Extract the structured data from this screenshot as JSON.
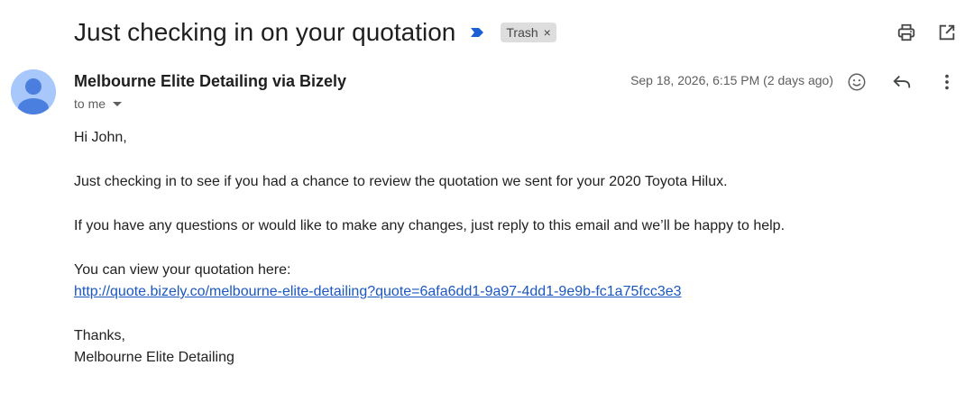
{
  "header": {
    "subject": "Just checking in on your quotation",
    "label": "Trash",
    "importance_icon": "importance-marker-icon",
    "print_icon": "print-icon",
    "open_new_window_icon": "open-in-new-icon"
  },
  "message": {
    "sender": "Melbourne Elite Detailing via Bizely",
    "recipient": "to me",
    "date": "Sep 18, 2026, 6:15 PM (2 days ago)",
    "avatar_icon": "default-person-avatar",
    "actions": {
      "emoji_icon": "emoji-reaction-icon",
      "reply_icon": "reply-icon",
      "more_icon": "more-vert-icon"
    }
  },
  "body": {
    "greeting": "Hi John,",
    "paragraph1": "Just checking in to see if you had a chance to review the quotation we sent for your 2020 Toyota Hilux.",
    "paragraph2": "If you have any questions or would like to make any changes, just reply to this email and we’ll be happy to help.",
    "view_text": "You can view your quotation here:",
    "link": "http://quote.bizely.co/melbourne-elite-detailing?quote=6afa6dd1-9a97-4dd1-9e9b-fc1a75fcc3e3",
    "signoff": "Thanks,",
    "signature": "Melbourne Elite Detailing"
  },
  "colors": {
    "link": "#1a57c0",
    "label_chip_bg": "#dddddd",
    "avatar_bg": "#a8c7fa",
    "avatar_fg": "#4a7fe0",
    "importance_marker": "#1a5fd6"
  }
}
